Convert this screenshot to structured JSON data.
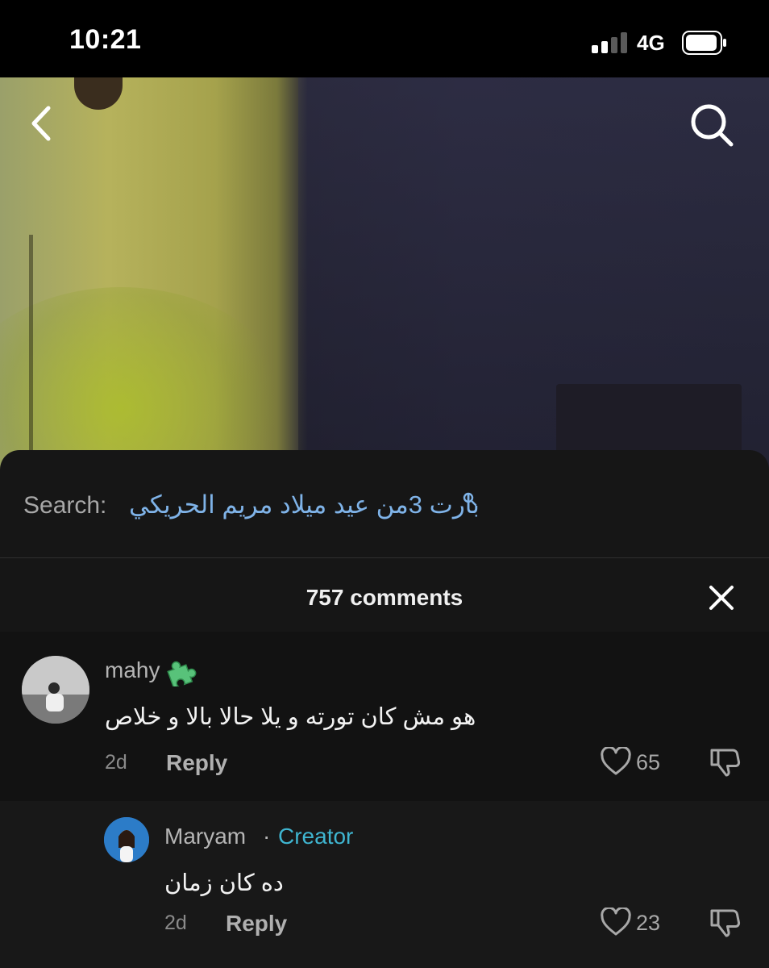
{
  "status_bar": {
    "time": "10:21",
    "network": "4G"
  },
  "colors": {
    "sheet_bg": "#161616",
    "search_link": "#7fb3e8",
    "creator_accent": "#3fb5d0"
  },
  "icons": {
    "back": "chevron-left-icon",
    "search": "search-icon",
    "close": "close-icon",
    "like": "heart-icon",
    "dislike": "thumbs-down-icon",
    "badge": "puzzle-piece-icon"
  },
  "search_suggestion": {
    "prefix": "Search:",
    "query": "بارت 3من عيد ميلاد مريم الحريكي"
  },
  "comments_header": {
    "count_label": "757 comments"
  },
  "comments": [
    {
      "username": "mahy",
      "text": "هو مش كان تورته و يلا حالا بالا و خلاص",
      "time": "2d",
      "reply_label": "Reply",
      "likes": "65"
    },
    {
      "username": "Maryam",
      "separator": "·",
      "badge": "Creator",
      "text": "ده كان زمان",
      "time": "2d",
      "reply_label": "Reply",
      "likes": "23"
    }
  ]
}
